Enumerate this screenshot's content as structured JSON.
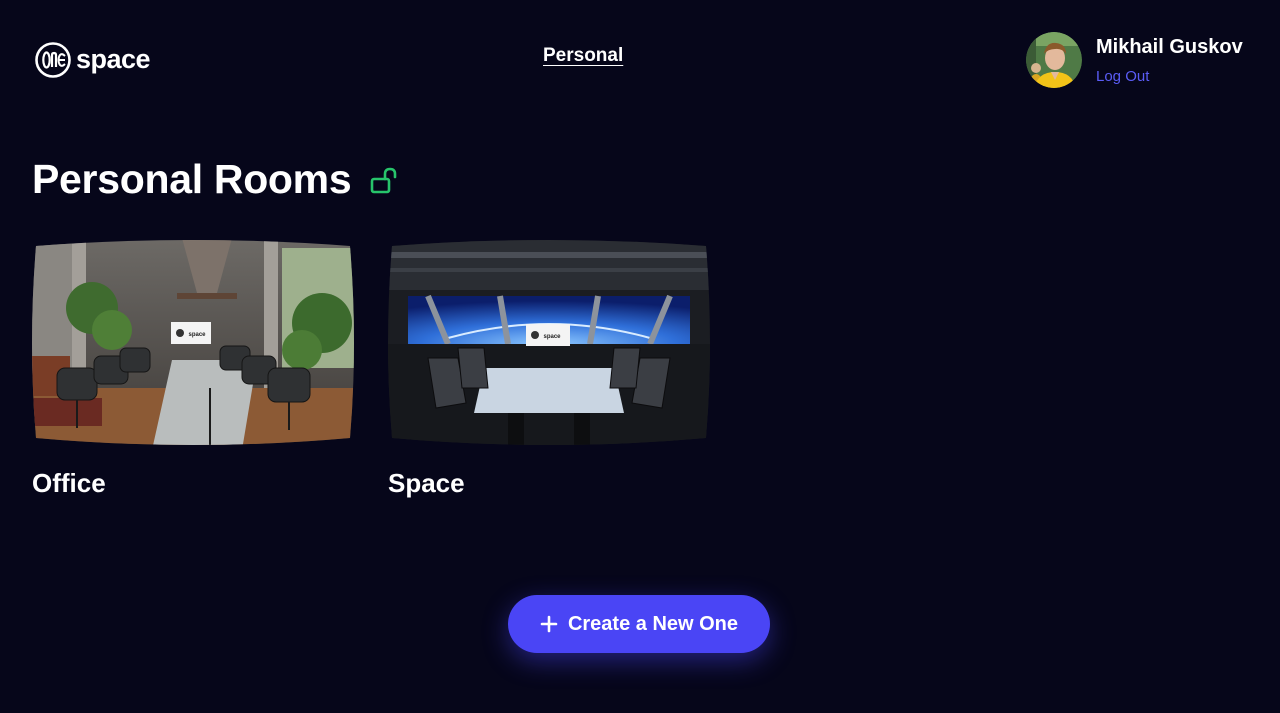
{
  "header": {
    "logo_text": "space",
    "logo_mark_text": "one",
    "nav_link": "Personal",
    "user": {
      "name": "Mikhail Guskov",
      "logout_label": "Log Out"
    }
  },
  "main": {
    "title": "Personal Rooms",
    "title_icon": "unlock-icon",
    "rooms": [
      {
        "label": "Office",
        "screen_text": "space"
      },
      {
        "label": "Space",
        "screen_text": "space"
      }
    ],
    "create_button": {
      "label": "Create a New One",
      "icon": "plus-icon"
    }
  },
  "colors": {
    "background": "#06061a",
    "accent": "#4a45f5",
    "link": "#5a5cf6",
    "lock": "#27c46b",
    "text": "#ffffff"
  }
}
